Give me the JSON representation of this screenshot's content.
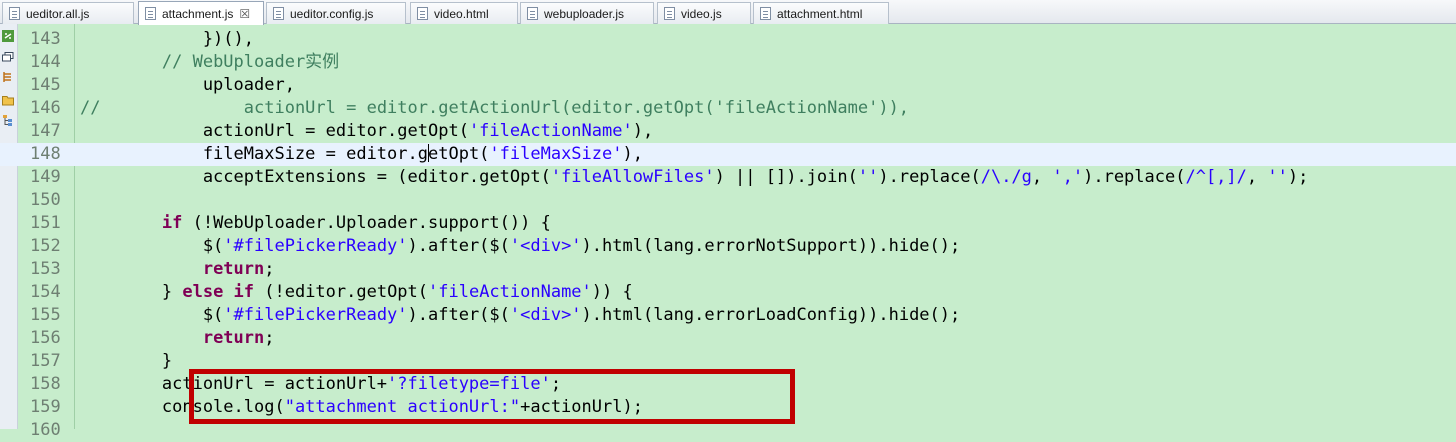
{
  "tabs": [
    {
      "label": "ueditor.all.js",
      "active": false
    },
    {
      "label": "attachment.js",
      "active": true,
      "close": "☒"
    },
    {
      "label": "ueditor.config.js",
      "active": false
    },
    {
      "label": "video.html",
      "active": false
    },
    {
      "label": "webuploader.js",
      "active": false
    },
    {
      "label": "video.js",
      "active": false
    },
    {
      "label": "attachment.html",
      "active": false
    }
  ],
  "gutter_icons": [
    "link-icon",
    "restore-icon",
    "outline-icon",
    "folder-icon",
    "hierarchy-icon"
  ],
  "colors": {
    "editor_bg": "#c7edcc",
    "keyword": "#7f0055",
    "string": "#2a00ff",
    "comment": "#3f7f5f",
    "highlight_box": "#c00000"
  },
  "current_line": 148,
  "lines": [
    {
      "n": "143",
      "segs": [
        {
          "t": "            })(),"
        }
      ]
    },
    {
      "n": "144",
      "segs": [
        {
          "t": "        "
        },
        {
          "t": "// WebUploader实例",
          "c": "cm"
        }
      ]
    },
    {
      "n": "145",
      "segs": [
        {
          "t": "            uploader,"
        }
      ]
    },
    {
      "n": "146",
      "segs": [
        {
          "t": "//",
          "c": "cm"
        },
        {
          "t": "              actionUrl = editor.getActionUrl(editor.getOpt('fileActionName')),",
          "c": "cm"
        }
      ]
    },
    {
      "n": "147",
      "segs": [
        {
          "t": "            actionUrl = editor.getOpt("
        },
        {
          "t": "'fileActionName'",
          "c": "str"
        },
        {
          "t": "),"
        }
      ]
    },
    {
      "n": "148",
      "segs": [
        {
          "t": "            fileMaxSize = editor.g"
        },
        {
          "caret": true
        },
        {
          "t": "etOpt("
        },
        {
          "t": "'fileMaxSize'",
          "c": "str"
        },
        {
          "t": "),"
        }
      ]
    },
    {
      "n": "149",
      "segs": [
        {
          "t": "            acceptExtensions = (editor.getOpt("
        },
        {
          "t": "'fileAllowFiles'",
          "c": "str"
        },
        {
          "t": ") || []).join("
        },
        {
          "t": "''",
          "c": "str"
        },
        {
          "t": ").replace("
        },
        {
          "t": "/\\./g",
          "c": "str"
        },
        {
          "t": ", "
        },
        {
          "t": "','",
          "c": "str"
        },
        {
          "t": ").replace("
        },
        {
          "t": "/^[,]/",
          "c": "str"
        },
        {
          "t": ", "
        },
        {
          "t": "''",
          "c": "str"
        },
        {
          "t": ");"
        }
      ]
    },
    {
      "n": "150",
      "segs": [
        {
          "t": ""
        }
      ]
    },
    {
      "n": "151",
      "segs": [
        {
          "t": "        "
        },
        {
          "t": "if",
          "c": "kw"
        },
        {
          "t": " (!WebUploader.Uploader.support()) {"
        }
      ]
    },
    {
      "n": "152",
      "segs": [
        {
          "t": "            $("
        },
        {
          "t": "'#filePickerReady'",
          "c": "str"
        },
        {
          "t": ").after($("
        },
        {
          "t": "'<div>'",
          "c": "str"
        },
        {
          "t": ").html(lang.errorNotSupport)).hide();"
        }
      ]
    },
    {
      "n": "153",
      "segs": [
        {
          "t": "            "
        },
        {
          "t": "return",
          "c": "kw"
        },
        {
          "t": ";"
        }
      ]
    },
    {
      "n": "154",
      "segs": [
        {
          "t": "        } "
        },
        {
          "t": "else if",
          "c": "kw"
        },
        {
          "t": " (!editor.getOpt("
        },
        {
          "t": "'fileActionName'",
          "c": "str"
        },
        {
          "t": ")) {"
        }
      ]
    },
    {
      "n": "155",
      "segs": [
        {
          "t": "            $("
        },
        {
          "t": "'#filePickerReady'",
          "c": "str"
        },
        {
          "t": ").after($("
        },
        {
          "t": "'<div>'",
          "c": "str"
        },
        {
          "t": ").html(lang.errorLoadConfig)).hide();"
        }
      ]
    },
    {
      "n": "156",
      "segs": [
        {
          "t": "            "
        },
        {
          "t": "return",
          "c": "kw"
        },
        {
          "t": ";"
        }
      ]
    },
    {
      "n": "157",
      "segs": [
        {
          "t": "        }"
        }
      ]
    },
    {
      "n": "158",
      "segs": [
        {
          "t": "        actionUrl = actionUrl+"
        },
        {
          "t": "'?filetype=file'",
          "c": "str"
        },
        {
          "t": ";"
        }
      ]
    },
    {
      "n": "159",
      "segs": [
        {
          "t": "        console.log("
        },
        {
          "t": "\"attachment actionUrl:\"",
          "c": "str"
        },
        {
          "t": "+actionUrl);"
        }
      ]
    },
    {
      "n": "160",
      "segs": [
        {
          "t": ""
        }
      ]
    }
  ]
}
